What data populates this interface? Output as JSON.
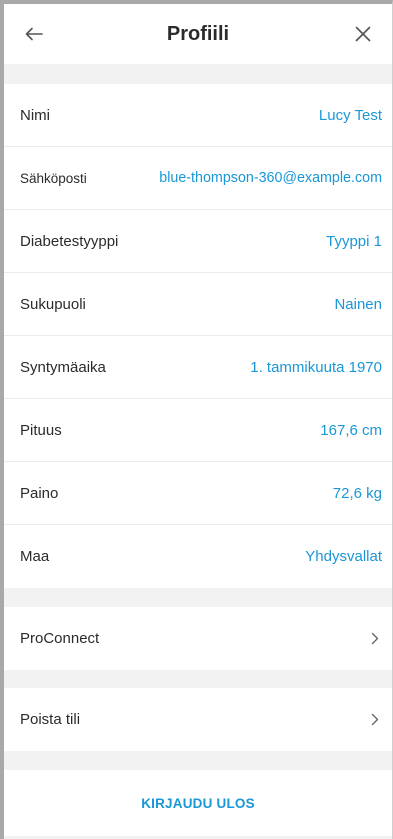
{
  "header": {
    "title": "Profiili",
    "back_icon": "arrow-left-icon",
    "close_icon": "close-icon"
  },
  "profile": {
    "rows": [
      {
        "label": "Nimi",
        "value": "Lucy Test"
      },
      {
        "label": "Sähköposti",
        "value": "blue-thompson-360@example.com"
      },
      {
        "label": "Diabetestyyppi",
        "value": "Tyyppi 1"
      },
      {
        "label": "Sukupuoli",
        "value": "Nainen"
      },
      {
        "label": "Syntymäaika",
        "value": "1. tammikuuta 1970"
      },
      {
        "label": "Pituus",
        "value": "167,6 cm"
      },
      {
        "label": "Paino",
        "value": "72,6 kg"
      },
      {
        "label": "Maa",
        "value": "Yhdysvallat"
      }
    ]
  },
  "links": {
    "proconnect": "ProConnect",
    "delete_account": "Poista tili",
    "chevron_icon": "chevron-right-icon"
  },
  "signout_label": "KIRJAUDU ULOS",
  "colors": {
    "accent": "#1a97d6",
    "background": "#f2f2f2",
    "text": "#2b2b2b"
  }
}
